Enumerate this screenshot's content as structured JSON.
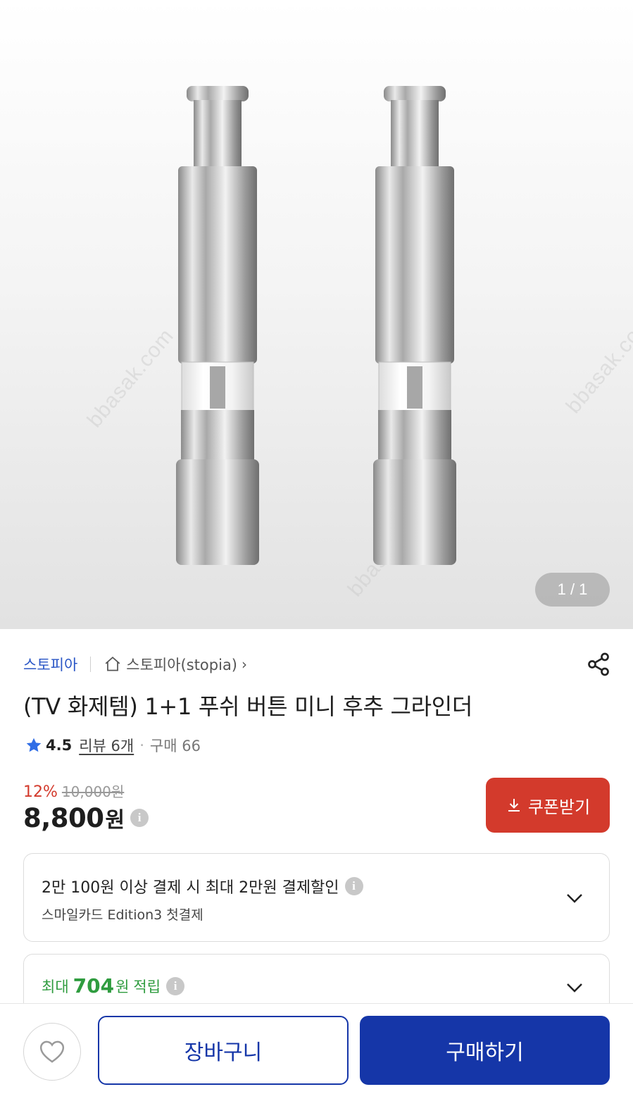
{
  "gallery": {
    "page_indicator": "1 / 1",
    "watermark": "bbasak.com"
  },
  "seller": {
    "brand": "스토피아",
    "store_name": "스토피아(stopia)",
    "store_chevron": "›"
  },
  "product": {
    "title": "(TV 화제템) 1+1 푸쉬 버튼 미니 후추 그라인더",
    "rating": "4.5",
    "review_label": "리뷰 6개",
    "dot": "·",
    "purchase_label": "구매 66",
    "discount_pct": "12%",
    "original_price": "10,000원",
    "price": "8,800",
    "price_unit": "원",
    "info_glyph": "i"
  },
  "coupon": {
    "label": "쿠폰받기"
  },
  "benefits": {
    "card_discount": {
      "main": "2만 100원 이상 결제 시 최대 2만원 결제할인",
      "sub": "스마일카드 Edition3 첫결제"
    },
    "points": {
      "prefix": "최대",
      "value": "704",
      "unit": "원",
      "suffix": "적립"
    }
  },
  "bottom_bar": {
    "cart_label": "장바구니",
    "buy_label": "구매하기"
  },
  "colors": {
    "accent_blue": "#1536a8",
    "seller_blue": "#2a56c6",
    "discount_red": "#d33a2c",
    "points_green": "#2f9c3f",
    "star_blue": "#2f6de6"
  },
  "icons": {
    "home": "home-icon",
    "share": "share-icon",
    "star": "star-icon",
    "info": "info-icon",
    "download": "download-icon",
    "chevron_down": "chevron-down-icon",
    "heart": "heart-icon"
  }
}
